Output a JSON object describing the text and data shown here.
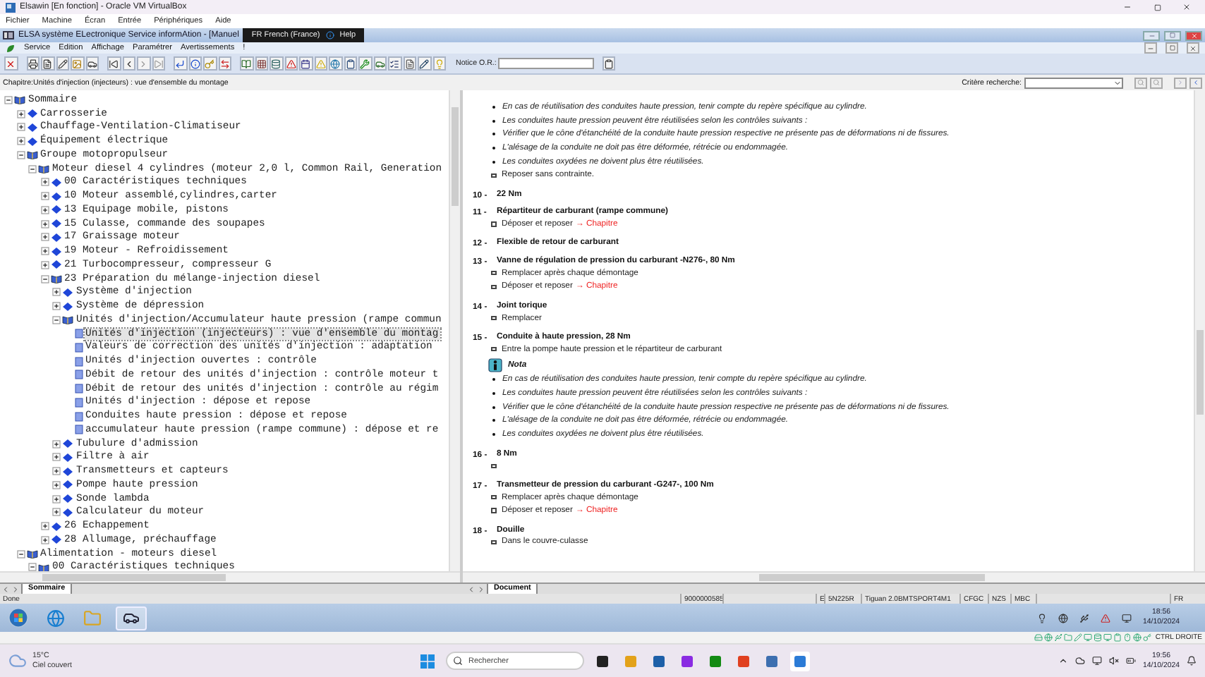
{
  "vbox_window": {
    "title": "Elsawin [En fonction] - Oracle VM VirtualBox",
    "menu": [
      "Fichier",
      "Machine",
      "Écran",
      "Entrée",
      "Périphériques",
      "Aide"
    ]
  },
  "elsa_window": {
    "title": "ELSA système ELectronique Service informAtion - [Manuel",
    "overlay": {
      "language": "FR French (France)",
      "help": "Help"
    },
    "menu": [
      "Service",
      "Edition",
      "Affichage",
      "Paramétrer",
      "Avertissements",
      "!"
    ],
    "notice_label": "Notice O.R.:"
  },
  "chapter_bar": {
    "chapter": "Chapitre:Unités d'injection (injecteurs) : vue d'ensemble du montage",
    "search_label": "Critère recherche:"
  },
  "tree": [
    {
      "kind": "chapter",
      "label": "Sommaire",
      "expanded": true,
      "selected": false,
      "children": [
        {
          "kind": "chapter",
          "label": "Carrosserie",
          "expanded": false,
          "selected": false
        },
        {
          "kind": "chapter",
          "label": "Chauffage-Ventilation-Climatiseur",
          "expanded": false,
          "selected": false
        },
        {
          "kind": "chapter",
          "label": "Équipement électrique",
          "expanded": false,
          "selected": false
        },
        {
          "kind": "chapter",
          "label": "Groupe motopropulseur",
          "expanded": true,
          "selected": false,
          "children": [
            {
              "kind": "chapter",
              "label": "Moteur diesel 4 cylindres (moteur 2,0 l, Common Rail, Generation",
              "expanded": true,
              "selected": false,
              "children": [
                {
                  "kind": "chapter",
                  "label": "00 Caractéristiques techniques",
                  "expanded": false,
                  "selected": false
                },
                {
                  "kind": "chapter",
                  "label": "10 Moteur assemblé,cylindres,carter",
                  "expanded": false,
                  "selected": false
                },
                {
                  "kind": "chapter",
                  "label": "13 Equipage mobile, pistons",
                  "expanded": false,
                  "selected": false
                },
                {
                  "kind": "chapter",
                  "label": "15 Culasse, commande des soupapes",
                  "expanded": false,
                  "selected": false
                },
                {
                  "kind": "chapter",
                  "label": "17 Graissage moteur",
                  "expanded": false,
                  "selected": false
                },
                {
                  "kind": "chapter",
                  "label": "19 Moteur - Refroidissement",
                  "expanded": false,
                  "selected": false
                },
                {
                  "kind": "chapter",
                  "label": "21 Turbocompresseur, compresseur G",
                  "expanded": false,
                  "selected": false
                },
                {
                  "kind": "chapter",
                  "label": "23 Préparation du mélange-injection diesel",
                  "expanded": true,
                  "selected": false,
                  "children": [
                    {
                      "kind": "chapter",
                      "label": "Système d'injection",
                      "expanded": false,
                      "selected": false
                    },
                    {
                      "kind": "chapter",
                      "label": "Système de dépression",
                      "expanded": false,
                      "selected": false
                    },
                    {
                      "kind": "chapter",
                      "label": "Unités d'injection/Accumulateur haute pression (rampe commun",
                      "expanded": true,
                      "selected": false,
                      "children": [
                        {
                          "kind": "document",
                          "label": "Unités d'injection (injecteurs) : vue d'ensemble du montag",
                          "selected": true
                        },
                        {
                          "kind": "document",
                          "label": "Valeurs de correction des unités d'injection : adaptation",
                          "selected": false
                        },
                        {
                          "kind": "document",
                          "label": "Unités d'injection ouvertes : contrôle",
                          "selected": false
                        },
                        {
                          "kind": "document",
                          "label": "Débit de retour des unités d'injection : contrôle moteur t",
                          "selected": false
                        },
                        {
                          "kind": "document",
                          "label": "Débit de retour des unités d'injection : contrôle au régim",
                          "selected": false
                        },
                        {
                          "kind": "document",
                          "label": "Unités d'injection : dépose et repose",
                          "selected": false
                        },
                        {
                          "kind": "document",
                          "label": "Conduites haute pression : dépose et repose",
                          "selected": false
                        },
                        {
                          "kind": "document",
                          "label": "accumulateur haute pression (rampe commune) : dépose et re",
                          "selected": false
                        }
                      ]
                    },
                    {
                      "kind": "chapter",
                      "label": "Tubulure d'admission",
                      "expanded": false,
                      "selected": false
                    },
                    {
                      "kind": "chapter",
                      "label": "Filtre à air",
                      "expanded": false,
                      "selected": false
                    },
                    {
                      "kind": "chapter",
                      "label": "Transmetteurs et capteurs",
                      "expanded": false,
                      "selected": false
                    },
                    {
                      "kind": "chapter",
                      "label": "Pompe haute pression",
                      "expanded": false,
                      "selected": false
                    },
                    {
                      "kind": "chapter",
                      "label": "Sonde lambda",
                      "expanded": false,
                      "selected": false
                    },
                    {
                      "kind": "chapter",
                      "label": "Calculateur du moteur",
                      "expanded": false,
                      "selected": false
                    }
                  ]
                },
                {
                  "kind": "chapter",
                  "label": "26 Echappement",
                  "expanded": false,
                  "selected": false
                },
                {
                  "kind": "chapter",
                  "label": "28 Allumage, préchauffage",
                  "expanded": false,
                  "selected": false
                }
              ]
            }
          ]
        },
        {
          "kind": "chapter",
          "label": "Alimentation - moteurs diesel",
          "expanded": true,
          "selected": false,
          "children": [
            {
              "kind": "chapter",
              "label": "00 Caractéristiques techniques",
              "expanded": true,
              "selected": false
            }
          ]
        }
      ]
    }
  ],
  "document": [
    {
      "kind": "bullet",
      "text": "En cas de réutilisation des conduites haute pression, tenir compte du repère spécifique au cylindre."
    },
    {
      "kind": "bullet",
      "text": "Les conduites haute pression peuvent être réutilisées selon les contrôles suivants :"
    },
    {
      "kind": "bullet",
      "text": "Vérifier que le cône d'étanchéité de la conduite haute pression respective ne présente pas de déformations ni de fissures."
    },
    {
      "kind": "bullet",
      "text": "L'alésage de la conduite ne doit pas être déformée, rétrécie ou endommagée."
    },
    {
      "kind": "bullet",
      "text": "Les conduites oxydées ne doivent plus être réutilisées."
    },
    {
      "kind": "step",
      "text": "Reposer sans contrainte."
    },
    {
      "kind": "heading",
      "number": "10 -",
      "text": "22 Nm"
    },
    {
      "kind": "heading",
      "number": "11 -",
      "text": "Répartiteur de carburant (rampe commune)"
    },
    {
      "kind": "step",
      "text": "Déposer et reposer",
      "link": "→ Chapitre"
    },
    {
      "kind": "heading",
      "number": "12 -",
      "text": "Flexible de retour de carburant"
    },
    {
      "kind": "heading",
      "number": "13 -",
      "text": "Vanne de régulation de pression du carburant -N276-, 80 Nm"
    },
    {
      "kind": "step",
      "text": "Remplacer après chaque démontage"
    },
    {
      "kind": "step",
      "text": "Déposer et reposer",
      "link": "→ Chapitre"
    },
    {
      "kind": "heading",
      "number": "14 -",
      "text": "Joint torique"
    },
    {
      "kind": "step",
      "text": "Remplacer"
    },
    {
      "kind": "heading",
      "number": "15 -",
      "text": "Conduite à haute pression, 28 Nm"
    },
    {
      "kind": "step",
      "text": "Entre la pompe haute pression et le répartiteur de carburant"
    },
    {
      "kind": "nota",
      "text": "Nota"
    },
    {
      "kind": "bullet",
      "text": "En cas de réutilisation des conduites haute pression, tenir compte du repère spécifique au cylindre."
    },
    {
      "kind": "bullet",
      "text": "Les conduites haute pression peuvent être réutilisées selon les contrôles suivants :"
    },
    {
      "kind": "bullet",
      "text": "Vérifier que le cône d'étanchéité de la conduite haute pression respective ne présente pas de déformations ni de fissures."
    },
    {
      "kind": "bullet",
      "text": "L'alésage de la conduite ne doit pas être déformée, rétrécie ou endommagée."
    },
    {
      "kind": "bullet",
      "text": "Les conduites oxydées ne doivent plus être réutilisées."
    },
    {
      "kind": "heading",
      "number": "16 -",
      "text": "8 Nm"
    },
    {
      "kind": "step"
    },
    {
      "kind": "heading",
      "number": "17 -",
      "text": "Transmetteur de pression du carburant -G247-, 100 Nm"
    },
    {
      "kind": "step",
      "text": "Remplacer après chaque démontage"
    },
    {
      "kind": "step",
      "text": "Déposer et reposer",
      "link": "→ Chapitre"
    },
    {
      "kind": "heading",
      "number": "18 -",
      "text": "Douille"
    },
    {
      "kind": "step",
      "text": "Dans le couvre-culasse"
    }
  ],
  "tabs": {
    "left": {
      "label": "Sommaire",
      "selected": true
    },
    "right": {
      "label": "Document",
      "selected": true
    }
  },
  "status_bar": {
    "message": "Done",
    "cells": [
      "9000000585",
      "E",
      "5N225R",
      "Tiguan 2.0BMTSPORT4M1",
      "CFGC",
      "NZS",
      "MBC",
      "FR"
    ]
  },
  "guest_taskbar": {
    "time": "18:56",
    "date": "14/10/2024"
  },
  "vbox_status": {
    "host_key": "CTRL DROITE"
  },
  "host_taskbar": {
    "temperature": "15°C",
    "weather": "Ciel couvert",
    "search_placeholder": "Rechercher",
    "time": "19:56",
    "date": "14/10/2024"
  }
}
